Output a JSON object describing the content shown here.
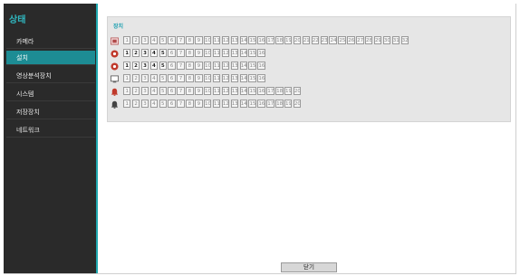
{
  "sidebar": {
    "title": "상태",
    "items": [
      {
        "label": "카메라",
        "active": false
      },
      {
        "label": "설치",
        "active": true
      },
      {
        "label": "영상분석장치",
        "active": false
      },
      {
        "label": "시스템",
        "active": false
      },
      {
        "label": "저장장치",
        "active": false
      },
      {
        "label": "네트워크",
        "active": false
      }
    ]
  },
  "main": {
    "section_label": "장치",
    "rows": [
      {
        "icon": "camera-icon",
        "icon_color": "#b04a4a",
        "count": 32,
        "active": []
      },
      {
        "icon": "record-icon",
        "icon_color": "#c0392b",
        "count": 16,
        "active": [
          1,
          2,
          3,
          4,
          5
        ]
      },
      {
        "icon": "record-icon",
        "icon_color": "#c0392b",
        "count": 16,
        "active": [
          1,
          2,
          3,
          4,
          5
        ]
      },
      {
        "icon": "monitor-icon",
        "icon_color": "#555555",
        "count": 16,
        "active": []
      },
      {
        "icon": "alarm-icon",
        "icon_color": "#c0392b",
        "count": 20,
        "active": []
      },
      {
        "icon": "bell-icon",
        "icon_color": "#444444",
        "count": 20,
        "active": []
      }
    ]
  },
  "footer": {
    "close_label": "닫기"
  }
}
